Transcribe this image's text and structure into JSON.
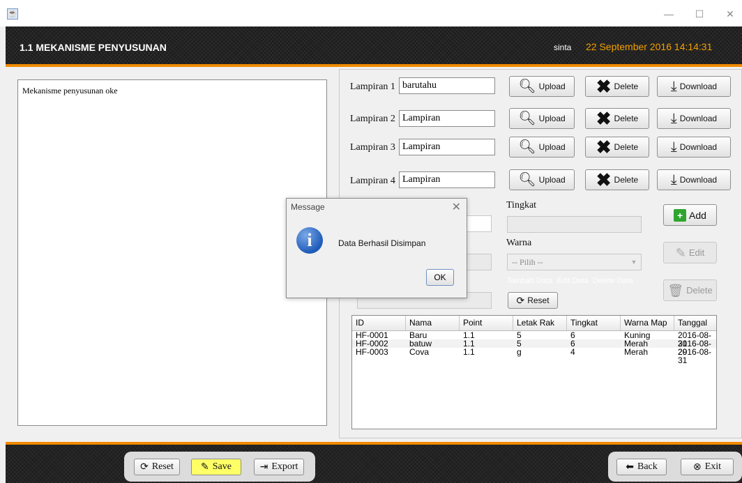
{
  "window": {
    "minimize": "—",
    "maximize": "☐",
    "close": "✕",
    "app_icon": "☕"
  },
  "header": {
    "title": "1.1 MEKANISME PENYUSUNAN",
    "user": "sinta",
    "datetime": "22 September 2016  14:14:31"
  },
  "editor": {
    "content": "Mekanisme penyusunan oke"
  },
  "attachments": [
    {
      "label": "Lampiran 1",
      "value": "barutahu"
    },
    {
      "label": "Lampiran 2",
      "value": "Lampiran"
    },
    {
      "label": "Lampiran 3",
      "value": "Lampiran"
    },
    {
      "label": "Lampiran 4",
      "value": "Lampiran"
    }
  ],
  "attachment_buttons": {
    "upload": "Upload",
    "delete": "Delete",
    "download": "Download"
  },
  "form": {
    "tingkat_label": "Tingkat",
    "warna_label": "Warna",
    "warna_select": "-- Pilih --",
    "links": [
      "Tambah Data",
      "Edit Data",
      "Delete Data"
    ],
    "reset_label": "Reset",
    "add_label": "Add",
    "edit_label": "Edit",
    "delete_label": "Delete"
  },
  "table": {
    "columns": [
      "ID",
      "Nama",
      "Point",
      "Letak Rak",
      "Tingkat",
      "Warna Map",
      "Tanggal"
    ],
    "rows": [
      [
        "HF-0001",
        "Baru",
        "1.1",
        "5",
        "6",
        "Kuning",
        "2016-08-31"
      ],
      [
        "HF-0002",
        "batuw",
        "1.1",
        "5",
        "6",
        "Merah",
        "2016-08-29"
      ],
      [
        "HF-0003",
        "Cova",
        "1.1",
        "g",
        "4",
        "Merah",
        "2016-08-31"
      ]
    ]
  },
  "footer": {
    "reset": "Reset",
    "save": "Save",
    "export": "Export",
    "back": "Back",
    "exit": "Exit"
  },
  "dialog": {
    "title": "Message",
    "message": "Data Berhasil Disimpan",
    "ok": "OK",
    "close": "✕"
  },
  "colors": {
    "accent": "#f08a00",
    "header_bg": "#1e1e1e",
    "datetime": "#f3a000",
    "save_btn": "#ffff66"
  }
}
